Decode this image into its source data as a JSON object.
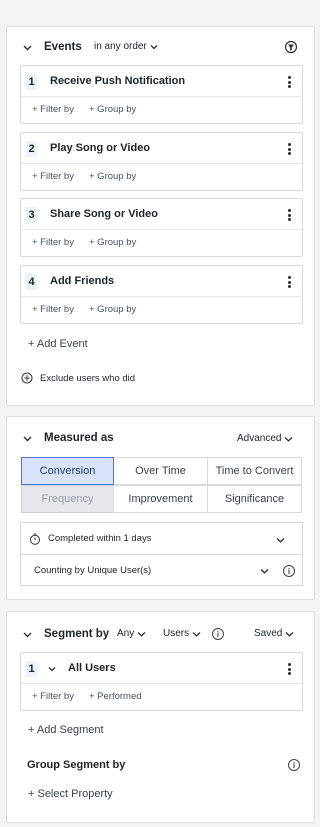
{
  "events": {
    "title": "Events",
    "order_label": "in any order",
    "items": [
      {
        "num": "1",
        "name": "Receive Push Notification",
        "filter": "+ Filter by",
        "group": "+ Group by"
      },
      {
        "num": "2",
        "name": "Play Song or Video",
        "filter": "+ Filter by",
        "group": "+ Group by"
      },
      {
        "num": "3",
        "name": "Share Song or Video",
        "filter": "+ Filter by",
        "group": "+ Group by"
      },
      {
        "num": "4",
        "name": "Add Friends",
        "filter": "+ Filter by",
        "group": "+ Group by"
      }
    ],
    "add_event": "+ Add Event",
    "exclude": "Exclude users who did"
  },
  "measured": {
    "title": "Measured as",
    "advanced": "Advanced",
    "options_row1": [
      "Conversion",
      "Over Time",
      "Time to Convert"
    ],
    "options_row2": [
      "Frequency",
      "Improvement",
      "Significance"
    ],
    "selected": "Conversion",
    "disabled": "Frequency",
    "completed_within": "Completed within 1 days",
    "counting_by": "Counting by Unique User(s)"
  },
  "segment": {
    "title": "Segment by",
    "any_label": "Any",
    "users_label": "Users",
    "saved_label": "Saved",
    "item": {
      "num": "1",
      "name": "All Users",
      "filter": "+ Filter by",
      "performed": "+ Performed"
    },
    "add_segment": "+ Add Segment",
    "group_title": "Group Segment by",
    "select_property": "+ Select Property"
  },
  "colors": {
    "accent": "#4a7bd6",
    "selected_bg": "#d8e4fb",
    "number_bg": "#eef2fa"
  }
}
